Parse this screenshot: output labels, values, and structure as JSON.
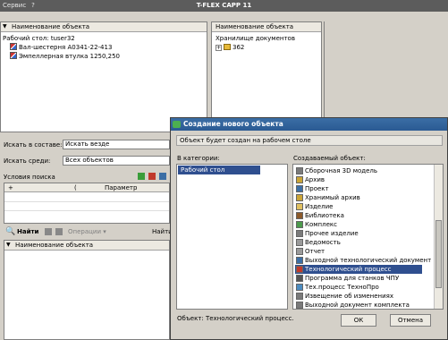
{
  "app": {
    "title": "T-FLEX CAPP 11",
    "menu": [
      "Сервис",
      "?"
    ]
  },
  "left_panel": {
    "header": "Наименование объекта",
    "root": "Рабочий стол: tuser32",
    "items": [
      "Вал-шестерня A0341-22-413",
      "Эмпеллерная втулка 1250,250"
    ]
  },
  "mid_panel": {
    "header": "Наименование объекта",
    "root": "Хранилище документов",
    "items": [
      "362"
    ]
  },
  "search": {
    "in_label": "Искать в составе:",
    "in_value": "Искать везде",
    "among_label": "Искать среди:",
    "among_value": "Всех объектов",
    "conditions_label": "Условия поиска",
    "col_plus": "+",
    "col_paren": "(",
    "col_param": "Параметр",
    "find_label": "Найти",
    "operations_label": "Операции",
    "find_right": "Найти",
    "results_header": "Наименование объекта"
  },
  "dialog": {
    "title": "Создание нового объекта",
    "notice": "Объект будет создан на рабочем столе",
    "category_label": "В категории:",
    "category_items": [
      "Рабочий стол"
    ],
    "object_label": "Создаваемый объект:",
    "object_items": [
      "Сборочная 3D модель",
      "Архив",
      "Проект",
      "Хранимый архив",
      "Изделие",
      "Библиотека",
      "Комплекс",
      "Прочее изделие",
      "Ведомость",
      "Отчет",
      "Выходной технологический документ",
      "Технологический процесс",
      "Программа для станков ЧПУ",
      "Тех.процесс ТехноПро",
      "Извещение об изменениях",
      "Выходной документ комплекта"
    ],
    "selected_index": 11,
    "status": "Объект: Технологический процесс.",
    "ok_label": "ОК",
    "cancel_label": "Отмена"
  }
}
